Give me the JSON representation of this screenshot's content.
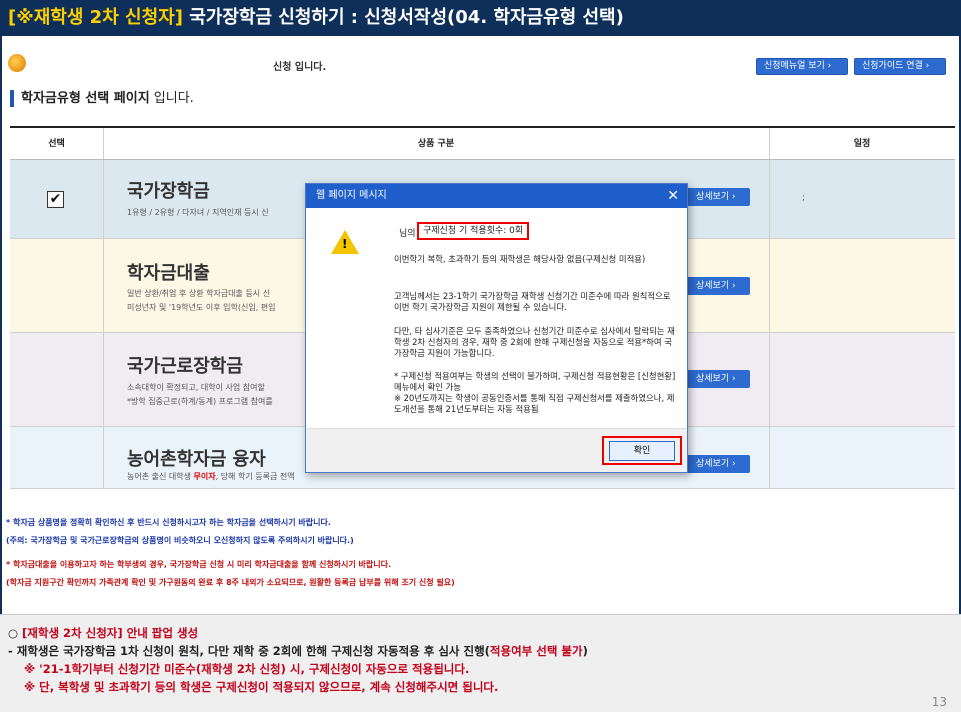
{
  "slide": {
    "title_highlight": "[※재학생 2차 신청자]",
    "title_rest": " 국가장학금 신청하기 : 신청서작성(04. 학자금유형 선택)",
    "page_number": "13"
  },
  "header": {
    "message": "신청 입니다.",
    "manual_button": "신청메뉴얼 보기 ›",
    "guide_button": "신청가이드 연결 ›"
  },
  "page_heading": {
    "bold": "학자금유형 선택 페이지",
    "rest": " 입니다."
  },
  "table": {
    "headers": [
      "선택",
      "상품 구분",
      "일정"
    ],
    "detail_label": "상세보기 ›",
    "schedule_value": ";",
    "rows": [
      {
        "name": "국가장학금",
        "desc1": "1유형 / 2유형 / 다자녀 / 지역인재 등시 신",
        "checked": "✔"
      },
      {
        "name": "학자금대출",
        "desc1": "일반 상환/취업 후 상환 학자금대출 등시 신",
        "desc2": "미성년자 및 '19학년도 이후 입학(신입, 편입"
      },
      {
        "name": "국가근로장학금",
        "desc1": "소속대학이 확정되고, 대학이 사업 참여할",
        "desc2": "*방학 집중근로(하계/동계) 프로그램 참여를"
      },
      {
        "name": "농어촌학자금 융자",
        "desc_pre": "농어촌 출신 대학생 ",
        "desc_red": "무이자",
        "desc_post": ", 당해 학기 등록금 전액"
      }
    ]
  },
  "notices": {
    "n1": "* 학자금 상품명을 정확히 확인하신 후 반드시 신청하시고자 하는 학자금을 선택하시기 바랍니다.",
    "n2": "(주의: 국가장학금 및 국가근로장학금의 상품명이 비슷하오니 오신청하지 않도록 주의하시기 바랍니다.)",
    "n3": "* 학자금대출을 이용하고자 하는 학부생의 경우, 국가장학금 신청 시 미리 학자금대출을 함께 신청하시기 바랍니다.",
    "n4": "(학자금 지원구간 확인까지 가족관계 확인 및 가구원동의 완료 후 8주 내외가 소요되므로, 원활한 등록금 납부를 위해 조기 신청 필요)"
  },
  "modal": {
    "title": "웹 페이지 메시지",
    "close": "✕",
    "warn_mark": "!",
    "line1_prefix": "님의",
    "count_text": "구제신청 기 적용횟수: 0회",
    "para1": "이번학기 복학, 초과학기 등의 재학생은 해당사항 없음(구제신청 미적용)",
    "para2": "고객님께서는 23-1학기 국가장학금 재학생 신청기간 미준수에 따라 원칙적으로 이번 학기 국가장학금 지원이 제한될 수 있습니다.",
    "para3": "다만, 타 심사기준은 모두 충족하였으나 신청기간 미준수로 심사에서 탈락되는 재학생 2차 신청자의 경우, 재학 중 2회에 한해 구제신청을 자동으로 적용*하여 국가장학금 지원이 가능합니다.",
    "para4": "* 구제신청 적용여부는 학생의 선택이 불가하며, 구제신청 적용현황은 [신청현황]메뉴에서 확인 가능",
    "para5": "※ 20년도까지는 학생이 공동인증서를 통해 직접 구제신청서를 제출하였으나, 제도개선을 통해 21년도부터는 자동 적용됨",
    "ok": "확인"
  },
  "bottom": {
    "line1_pre": "○ ",
    "line1_red": "[재학생 2차 신청자] 안내 팝업 생성",
    "line2_pre": " - 재학생은 국가장학금 1차 신청이 원칙, 다만 재학 중 2회에 한해 구제신청 자동적용 후 심사 진행(",
    "line2_red": "적용여부 선택 불가",
    "line2_post": ")",
    "line3": "※ '21-1학기부터 신청기간 미준수(재학생 2차 신청) 시, 구제신청이 자동으로 적용됩니다.",
    "line4": "※ 단, 복학생 및 초과학기 등의 학생은 구제신청이 적용되지 않으므로, 계속 신청해주시면 됩니다."
  }
}
